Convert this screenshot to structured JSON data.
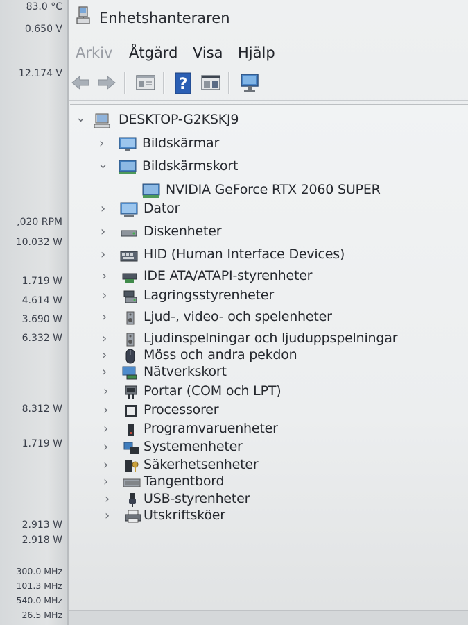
{
  "sensors": [
    {
      "id": "temp",
      "text": "83.0 °C"
    },
    {
      "id": "volt1",
      "text": "0.650 V"
    },
    {
      "id": "volt2",
      "text": "12.174 V"
    },
    {
      "id": "rpm",
      "text": ",020 RPM"
    },
    {
      "id": "w1",
      "text": "10.032 W"
    },
    {
      "id": "w2",
      "text": "1.719 W"
    },
    {
      "id": "w3",
      "text": "4.614 W"
    },
    {
      "id": "w4",
      "text": "3.690 W"
    },
    {
      "id": "w5",
      "text": "6.332 W"
    },
    {
      "id": "w6",
      "text": "8.312 W"
    },
    {
      "id": "w7",
      "text": "1.719 W"
    },
    {
      "id": "w8",
      "text": "2.913 W"
    },
    {
      "id": "w9",
      "text": "2.918 W"
    },
    {
      "id": "f1",
      "text": "300.0 MHz"
    },
    {
      "id": "f2",
      "text": "101.3 MHz"
    },
    {
      "id": "f3",
      "text": "540.0 MHz"
    },
    {
      "id": "f4",
      "text": "26.5 MHz"
    }
  ],
  "window": {
    "title": "Enhetshanteraren",
    "title_icon": "device-manager-icon"
  },
  "menu": {
    "arkiv": "Arkiv",
    "atgard": "Åtgärd",
    "visa": "Visa",
    "hjalp": "Hjälp"
  },
  "toolbar": {
    "back_icon": "arrow-left-icon",
    "forward_icon": "arrow-right-icon",
    "properties_icon": "properties-icon",
    "help_icon": "help-icon",
    "view_icon": "view-icon",
    "scan_icon": "monitor-scan-icon"
  },
  "tree": {
    "root": "DESKTOP-G2KSKJ9",
    "items": [
      {
        "label": "Bildskärmar",
        "expanded": false
      },
      {
        "label": "Bildskärmskort",
        "expanded": true,
        "children": [
          "NVIDIA GeForce RTX 2060 SUPER"
        ]
      },
      {
        "label": "Dator",
        "expanded": false
      },
      {
        "label": "Diskenheter",
        "expanded": false
      },
      {
        "label": "HID (Human Interface Devices)",
        "expanded": false
      },
      {
        "label": "IDE ATA/ATAPI-styrenheter",
        "expanded": false
      },
      {
        "label": "Lagringsstyrenheter",
        "expanded": false
      },
      {
        "label": "Ljud-, video- och spelenheter",
        "expanded": false
      },
      {
        "label": "Ljudinspelningar och ljuduppspelningar",
        "expanded": false
      },
      {
        "label": "Möss och andra pekdon",
        "expanded": false
      },
      {
        "label": "Nätverkskort",
        "expanded": false
      },
      {
        "label": "Portar (COM och LPT)",
        "expanded": false
      },
      {
        "label": "Processorer",
        "expanded": false
      },
      {
        "label": "Programvaruenheter",
        "expanded": false
      },
      {
        "label": "Systemenheter",
        "expanded": false
      },
      {
        "label": "Säkerhetsenheter",
        "expanded": false
      },
      {
        "label": "Tangentbord",
        "expanded": false
      },
      {
        "label": "USB-styrenheter",
        "expanded": false
      },
      {
        "label": "Utskriftsköer",
        "expanded": false
      }
    ]
  }
}
